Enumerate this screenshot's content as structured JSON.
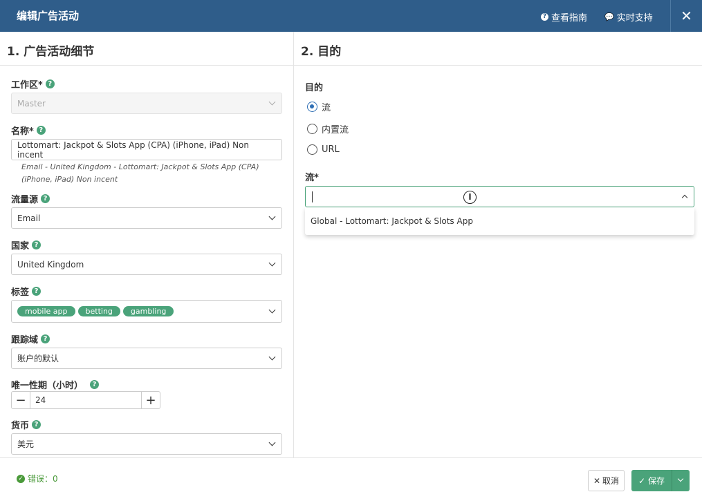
{
  "header": {
    "title": "编辑广告活动",
    "guide_label": "查看指南",
    "support_label": "实时支持",
    "close_label": "✕"
  },
  "left_panel": {
    "title": "1. 广告活动细节",
    "workspace": {
      "label": "工作区*",
      "value": "Master"
    },
    "name": {
      "label": "名称*",
      "value": "Lottomart: Jackpot & Slots App (CPA) (iPhone, iPad) Non incent",
      "hint": "Email - United Kingdom - Lottomart: Jackpot & Slots App (CPA) (iPhone, iPad) Non incent"
    },
    "traffic_source": {
      "label": "流量源",
      "value": "Email"
    },
    "country": {
      "label": "国家",
      "value": "United Kingdom"
    },
    "tags": {
      "label": "标签",
      "items": [
        "mobile app",
        "betting",
        "gambling"
      ]
    },
    "tracking_domain": {
      "label": "跟踪域",
      "value": "账户的默认"
    },
    "uniqueness": {
      "label": "唯一性期（小时）",
      "value": "24",
      "minus": "−",
      "plus": "+"
    },
    "currency": {
      "label": "货币",
      "value": "美元"
    }
  },
  "right_panel": {
    "title": "2. 目的",
    "destination_label": "目的",
    "options": [
      {
        "label": "流",
        "selected": true
      },
      {
        "label": "内置流",
        "selected": false
      },
      {
        "label": "URL",
        "selected": false
      }
    ],
    "flow_label": "流*",
    "flow_value": "",
    "dropdown_options": [
      "Global - Lottomart: Jackpot & Slots App"
    ]
  },
  "footer": {
    "errors_label": "错误：0",
    "cancel_label": "取消",
    "save_label": "保存"
  },
  "colors": {
    "header_bg": "#2f5d8a",
    "accent_green": "#4aa37a",
    "radio_blue": "#2f6fb5"
  }
}
